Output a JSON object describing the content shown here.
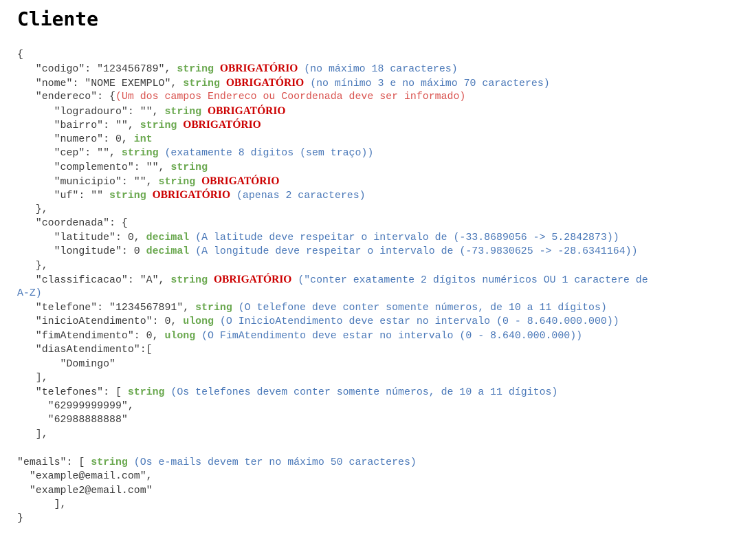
{
  "title": "Cliente",
  "colors": {
    "text": "#3a3a3a",
    "datatype": "#6aa84f",
    "required": "#cc0000",
    "note": "#4a78b8",
    "warning_note": "#d9534f"
  },
  "lines": [
    [
      {
        "k": "t",
        "v": "{"
      }
    ],
    [
      {
        "k": "t",
        "v": "   \"codigo\": \"123456789\", "
      },
      {
        "k": "dt",
        "v": "string"
      },
      {
        "k": "t",
        "v": " "
      },
      {
        "k": "req",
        "v": "OBRIGATÓRIO"
      },
      {
        "k": "t",
        "v": " "
      },
      {
        "k": "note",
        "v": "(no máximo 18 caracteres)"
      }
    ],
    [
      {
        "k": "t",
        "v": "   \"nome\": \"NOME EXEMPLO\", "
      },
      {
        "k": "dt",
        "v": "string"
      },
      {
        "k": "t",
        "v": " "
      },
      {
        "k": "req",
        "v": "OBRIGATÓRIO"
      },
      {
        "k": "t",
        "v": " "
      },
      {
        "k": "note",
        "v": "(no mínimo 3 e no máximo 70 caracteres)"
      }
    ],
    [
      {
        "k": "t",
        "v": "   \"endereco\": {"
      },
      {
        "k": "rnote",
        "v": "(Um dos campos Endereco ou Coordenada deve ser informado)"
      }
    ],
    [
      {
        "k": "t",
        "v": "      \"logradouro\": \"\", "
      },
      {
        "k": "dt",
        "v": "string"
      },
      {
        "k": "t",
        "v": " "
      },
      {
        "k": "req",
        "v": "OBRIGATÓRIO"
      }
    ],
    [
      {
        "k": "t",
        "v": "      \"bairro\": \"\", "
      },
      {
        "k": "dt",
        "v": "string"
      },
      {
        "k": "t",
        "v": " "
      },
      {
        "k": "req",
        "v": "OBRIGATÓRIO"
      }
    ],
    [
      {
        "k": "t",
        "v": "      \"numero\": 0, "
      },
      {
        "k": "dt",
        "v": "int"
      }
    ],
    [
      {
        "k": "t",
        "v": "      \"cep\": \"\", "
      },
      {
        "k": "dt",
        "v": "string"
      },
      {
        "k": "t",
        "v": " "
      },
      {
        "k": "note",
        "v": "(exatamente 8 dígitos (sem traço))"
      }
    ],
    [
      {
        "k": "t",
        "v": "      \"complemento\": \"\", "
      },
      {
        "k": "dt",
        "v": "string"
      }
    ],
    [
      {
        "k": "t",
        "v": "      \"municipio\": \"\", "
      },
      {
        "k": "dt",
        "v": "string"
      },
      {
        "k": "t",
        "v": " "
      },
      {
        "k": "req",
        "v": "OBRIGATÓRIO"
      }
    ],
    [
      {
        "k": "t",
        "v": "      \"uf\": \"\" "
      },
      {
        "k": "dt",
        "v": "string"
      },
      {
        "k": "t",
        "v": " "
      },
      {
        "k": "req",
        "v": "OBRIGATÓRIO"
      },
      {
        "k": "t",
        "v": " "
      },
      {
        "k": "note",
        "v": "(apenas 2 caracteres)"
      }
    ],
    [
      {
        "k": "t",
        "v": "   },"
      }
    ],
    [
      {
        "k": "t",
        "v": "   \"coordenada\": {"
      }
    ],
    [
      {
        "k": "t",
        "v": "      \"latitude\": 0, "
      },
      {
        "k": "dt",
        "v": "decimal"
      },
      {
        "k": "t",
        "v": " "
      },
      {
        "k": "note",
        "v": "(A latitude deve respeitar o intervalo de (-33.8689056 -> 5.2842873))"
      }
    ],
    [
      {
        "k": "t",
        "v": "      \"longitude\": 0 "
      },
      {
        "k": "dt",
        "v": "decimal"
      },
      {
        "k": "t",
        "v": " "
      },
      {
        "k": "note",
        "v": "(A longitude deve respeitar o intervalo de (-73.9830625 -> -28.6341164))"
      }
    ],
    [
      {
        "k": "t",
        "v": "   },"
      }
    ],
    [
      {
        "k": "t",
        "v": "   \"classificacao\": \"A\", "
      },
      {
        "k": "dt",
        "v": "string"
      },
      {
        "k": "t",
        "v": " "
      },
      {
        "k": "req",
        "v": "OBRIGATÓRIO"
      },
      {
        "k": "t",
        "v": " "
      },
      {
        "k": "note",
        "v": "(\"conter exatamente 2 dígitos numéricos OU 1 caractere de"
      }
    ],
    [
      {
        "k": "note",
        "v": "A-Z)"
      }
    ],
    [
      {
        "k": "t",
        "v": "   \"telefone\": \"1234567891\", "
      },
      {
        "k": "dt",
        "v": "string"
      },
      {
        "k": "t",
        "v": " "
      },
      {
        "k": "note",
        "v": "(O telefone deve conter somente números, de 10 a 11 dígitos)"
      }
    ],
    [
      {
        "k": "t",
        "v": "   \"inicioAtendimento\": 0, "
      },
      {
        "k": "dt",
        "v": "ulong"
      },
      {
        "k": "t",
        "v": " "
      },
      {
        "k": "note",
        "v": "(O InicioAtendimento deve estar no intervalo (0 - 8.640.000.000))"
      }
    ],
    [
      {
        "k": "t",
        "v": "   \"fimAtendimento\": 0, "
      },
      {
        "k": "dt",
        "v": "ulong"
      },
      {
        "k": "t",
        "v": " "
      },
      {
        "k": "note",
        "v": "(O FimAtendimento deve estar no intervalo (0 - 8.640.000.000))"
      }
    ],
    [
      {
        "k": "t",
        "v": "   \"diasAtendimento\":["
      }
    ],
    [
      {
        "k": "t",
        "v": "       \"Domingo\""
      }
    ],
    [
      {
        "k": "t",
        "v": "   ],"
      }
    ],
    [
      {
        "k": "t",
        "v": "   \"telefones\": [ "
      },
      {
        "k": "dt",
        "v": "string"
      },
      {
        "k": "t",
        "v": " "
      },
      {
        "k": "note",
        "v": "(Os telefones devem conter somente números, de 10 a 11 dígitos)"
      }
    ],
    [
      {
        "k": "t",
        "v": "     \"62999999999\","
      }
    ],
    [
      {
        "k": "t",
        "v": "     \"62988888888\""
      }
    ],
    [
      {
        "k": "t",
        "v": "   ],"
      }
    ],
    [
      {
        "k": "t",
        "v": ""
      }
    ],
    [
      {
        "k": "t",
        "v": "\"emails\": [ "
      },
      {
        "k": "dt",
        "v": "string"
      },
      {
        "k": "t",
        "v": " "
      },
      {
        "k": "note",
        "v": "(Os e-mails devem ter no máximo 50 caracteres)"
      }
    ],
    [
      {
        "k": "t",
        "v": "  \"example@email.com\","
      }
    ],
    [
      {
        "k": "t",
        "v": "  \"example2@email.com\""
      }
    ],
    [
      {
        "k": "t",
        "v": "      ],"
      }
    ],
    [
      {
        "k": "t",
        "v": "}"
      }
    ]
  ]
}
